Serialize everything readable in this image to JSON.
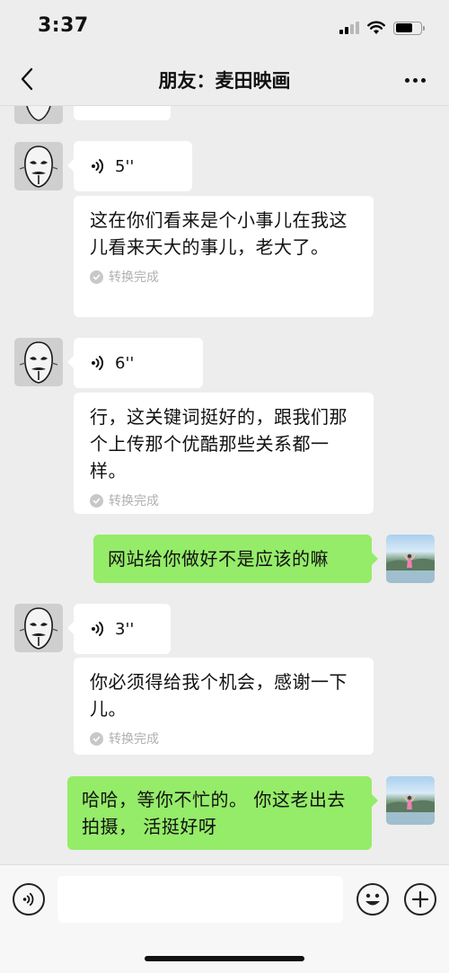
{
  "status_bar": {
    "time": "3:37",
    "battery_level": 0.7
  },
  "header": {
    "title": "朋友：麦田映画"
  },
  "messages": [
    {
      "side": "left",
      "type": "voice",
      "duration": "5''",
      "transcript": "这在你们看来是个小事儿在我这儿看来天大的事儿，老大了。",
      "status": "转换完成"
    },
    {
      "side": "left",
      "type": "voice",
      "duration": "6''",
      "transcript": "行，这关键词挺好的，跟我们那个上传那个优酷那些关系都一样。",
      "status": "转换完成"
    },
    {
      "side": "right",
      "type": "text",
      "text": "网站给你做好不是应该的嘛"
    },
    {
      "side": "left",
      "type": "voice",
      "duration": "3''",
      "transcript": "你必须得给我个机会，感谢一下儿。",
      "status": "转换完成"
    },
    {
      "side": "right",
      "type": "text",
      "text": "哈哈，等你不忙的。 你这老出去拍摄， 活挺好呀"
    }
  ],
  "input_bar": {
    "placeholder": ""
  },
  "colors": {
    "background": "#ededed",
    "bubble_in": "#ffffff",
    "bubble_out": "#95ec69",
    "muted_text": "#b0b0b0"
  },
  "icons": [
    "back-icon",
    "more-icon",
    "voice-wave-icon",
    "check-icon",
    "voice-input-icon",
    "emoji-icon",
    "plus-icon"
  ]
}
